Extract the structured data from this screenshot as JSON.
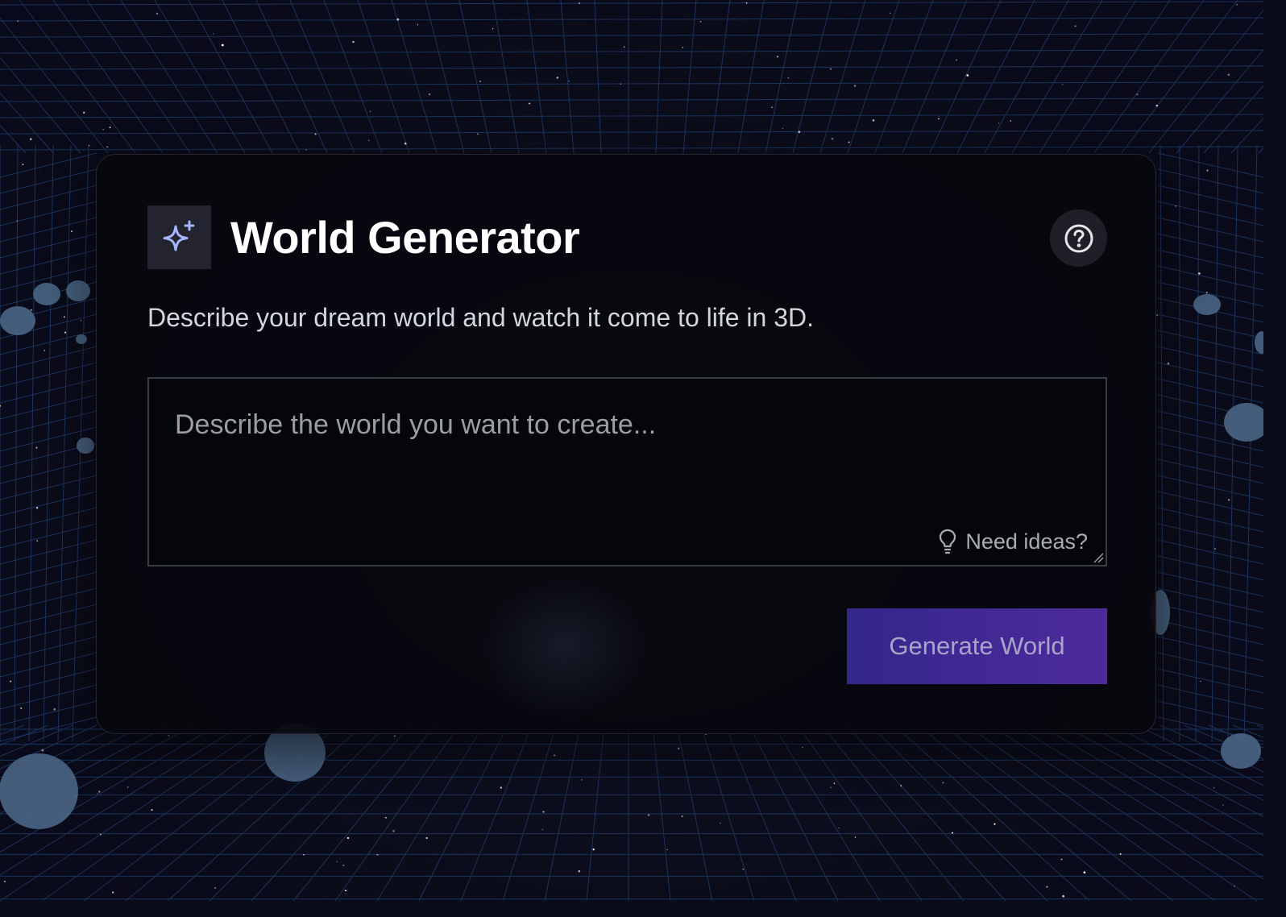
{
  "app": {
    "title": "World Generator",
    "subtitle": "Describe your dream world and watch it come to life in 3D."
  },
  "header": {
    "logo_icon": "sparkles-icon",
    "help_icon": "help-circle-icon"
  },
  "prompt": {
    "value": "",
    "placeholder": "Describe the world you want to create...",
    "ideas_label": "Need ideas?",
    "ideas_icon": "lightbulb-icon"
  },
  "actions": {
    "generate_label": "Generate World"
  },
  "colors": {
    "background": "#0b0c1a",
    "grid_line": "#1f3a66",
    "card": "#07080e",
    "accent_icon": "#a5b4fc",
    "button_start": "#33278a",
    "button_end": "#4e2a9c",
    "blob": "#4a6584"
  }
}
